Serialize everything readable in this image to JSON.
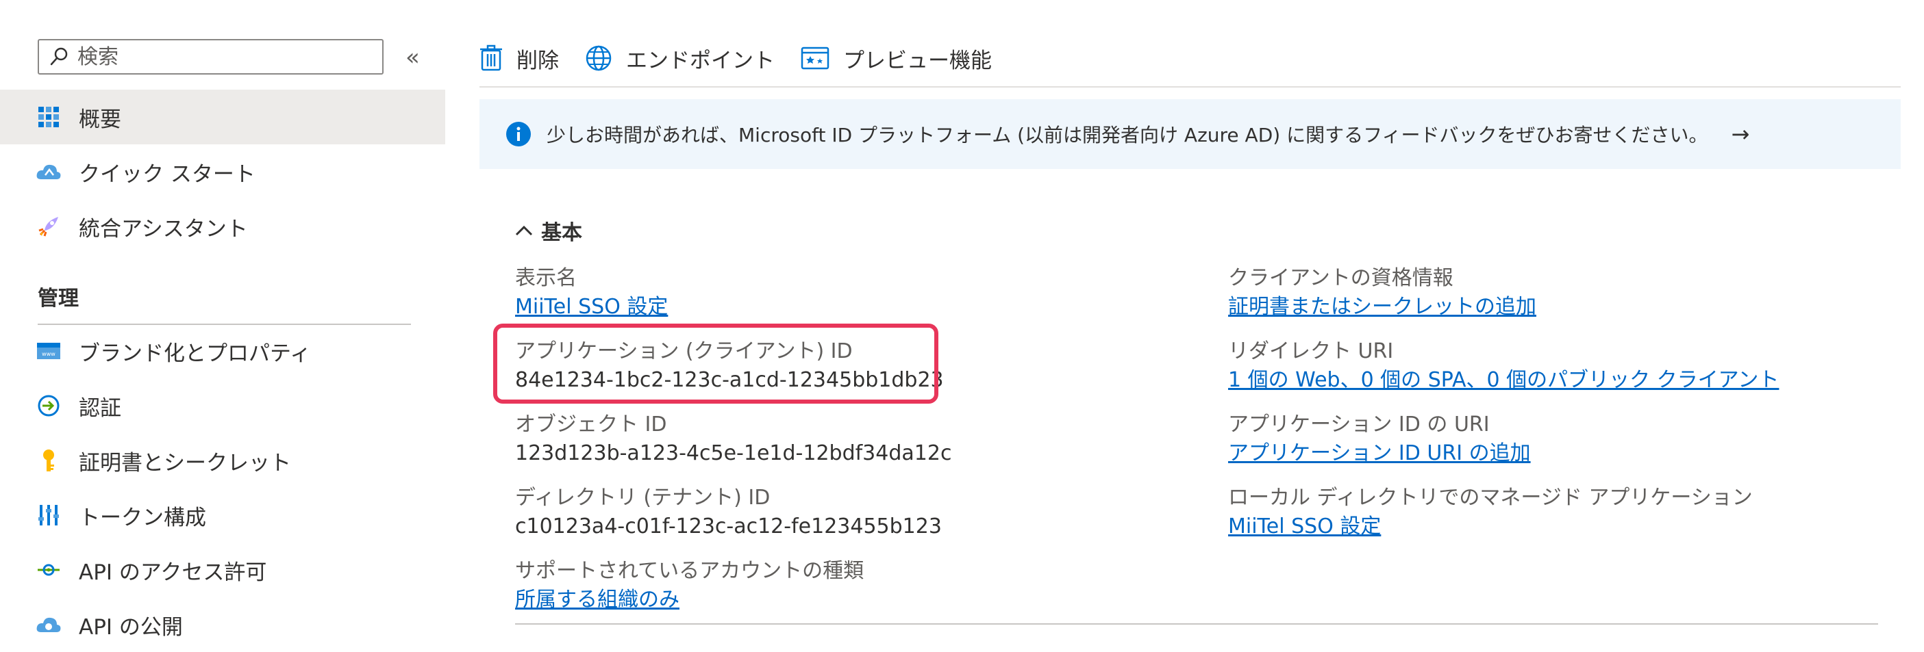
{
  "sidebar": {
    "search_placeholder": "検索",
    "collapse_icon": "«",
    "items": [
      {
        "label": "概要",
        "icon": "overview-grid-icon",
        "active": true
      },
      {
        "label": "クイック スタート",
        "icon": "cloud-quickstart-icon"
      },
      {
        "label": "統合アシスタント",
        "icon": "rocket-icon"
      }
    ],
    "section_label": "管理",
    "manage_items": [
      {
        "label": "ブランド化とプロパティ",
        "icon": "branding-icon"
      },
      {
        "label": "認証",
        "icon": "authentication-icon"
      },
      {
        "label": "証明書とシークレット",
        "icon": "key-icon"
      },
      {
        "label": "トークン構成",
        "icon": "token-config-icon"
      },
      {
        "label": "API のアクセス許可",
        "icon": "api-permissions-icon"
      },
      {
        "label": "API の公開",
        "icon": "expose-api-icon"
      }
    ]
  },
  "toolbar": {
    "delete_label": "削除",
    "endpoints_label": "エンドポイント",
    "preview_label": "プレビュー機能"
  },
  "banner": {
    "text": "少しお時間があれば、Microsoft ID プラットフォーム (以前は開発者向け Azure AD) に関するフィードバックをぜひお寄せください。",
    "arrow": "→"
  },
  "essentials": {
    "header": "基本",
    "left": [
      {
        "label": "表示名",
        "value": "MiiTel SSO 設定",
        "is_link": true
      },
      {
        "label": "アプリケーション (クライアント) ID",
        "value": "84e1234-1bc2-123c-a1cd-12345bb1db23",
        "is_link": false
      },
      {
        "label": "オブジェクト ID",
        "value": "123d123b-a123-4c5e-1e1d-12bdf34da12c",
        "is_link": false
      },
      {
        "label": "ディレクトリ (テナント) ID",
        "value": "c10123a4-c01f-123c-ac12-fe123455b123",
        "is_link": false
      },
      {
        "label": "サポートされているアカウントの種類",
        "value": "所属する組織のみ",
        "is_link": true
      }
    ],
    "right": [
      {
        "label": "クライアントの資格情報",
        "value": "証明書またはシークレットの追加",
        "is_link": true
      },
      {
        "label": "リダイレクト URI",
        "value": "1 個の Web、0 個の SPA、0 個のパブリック クライアント",
        "is_link": true
      },
      {
        "label": "アプリケーション ID の URI",
        "value": "アプリケーション ID URI の追加",
        "is_link": true
      },
      {
        "label": "ローカル ディレクトリでのマネージド アプリケーション",
        "value": "MiiTel SSO 設定",
        "is_link": true
      }
    ]
  },
  "colors": {
    "accent_link": "#0067c5",
    "highlight_border": "#e8365a",
    "banner_bg": "#eff6fc",
    "active_nav_bg": "#edebe9"
  }
}
